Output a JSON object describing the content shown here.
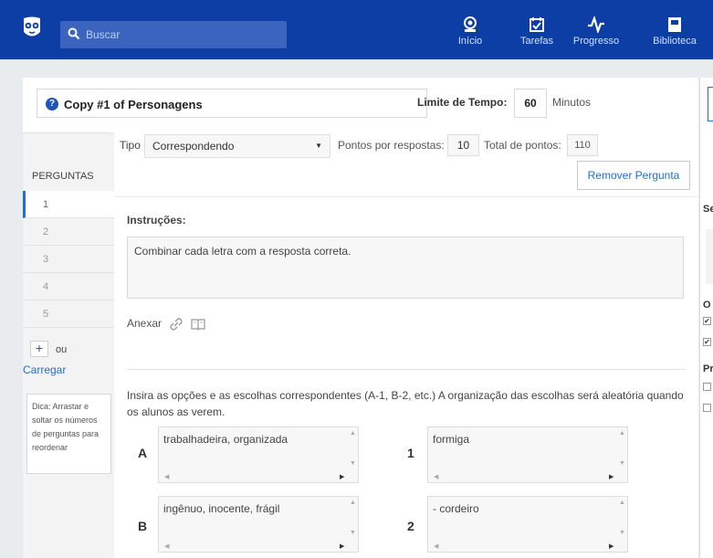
{
  "header": {
    "search_placeholder": "Buscar",
    "nav": [
      {
        "label": "Início",
        "icon": "home-icon"
      },
      {
        "label": "Tarefas",
        "icon": "calendar-check-icon"
      },
      {
        "label": "Progresso",
        "icon": "pulse-icon"
      },
      {
        "label": "Biblioteca",
        "icon": "library-icon"
      }
    ]
  },
  "quiz": {
    "title": "Copy #1 of Personagens",
    "time_limit_label": "Limite de Tempo:",
    "time_limit_value": "60",
    "time_unit": "Minutos"
  },
  "question_settings": {
    "type_label": "Tipo",
    "type_value": "Correspondendo",
    "points_label": "Pontos por respostas:",
    "points_value": "10",
    "total_label": "Total de pontos:",
    "total_value": "110",
    "remove_label": "Remover Pergunta"
  },
  "sidebar": {
    "questions_label": "PERGUNTAS",
    "items": [
      "1",
      "2",
      "3",
      "4",
      "5"
    ],
    "active_index": 0,
    "add_label": "+",
    "or_label": "ou",
    "upload_label": "Carregar",
    "tip": "Dica: Arrastar e soltar os números de perguntas para reordenar"
  },
  "content": {
    "instructions_label": "Instruções:",
    "instructions_text": "Combinar cada letra com a resposta correta.",
    "attach_label": "Anexar",
    "matching_help": "Insira as opções e as escolhas correspondentes (A-1, B-2, etc.) A organização das escolhas será aleatória quando os alunos as verem.",
    "pairs": [
      {
        "letter": "A",
        "option": "trabalhadeira, organizada",
        "number": "1",
        "choice": "formiga"
      },
      {
        "letter": "B",
        "option": "ingênuo, inocente, frágil",
        "number": "2",
        "choice": "- cordeiro"
      }
    ]
  },
  "right_panel": {
    "letters": [
      "Se",
      "O",
      "Pr"
    ]
  },
  "colors": {
    "topbar": "#0d3ea6",
    "accent": "#1f6fd1"
  }
}
